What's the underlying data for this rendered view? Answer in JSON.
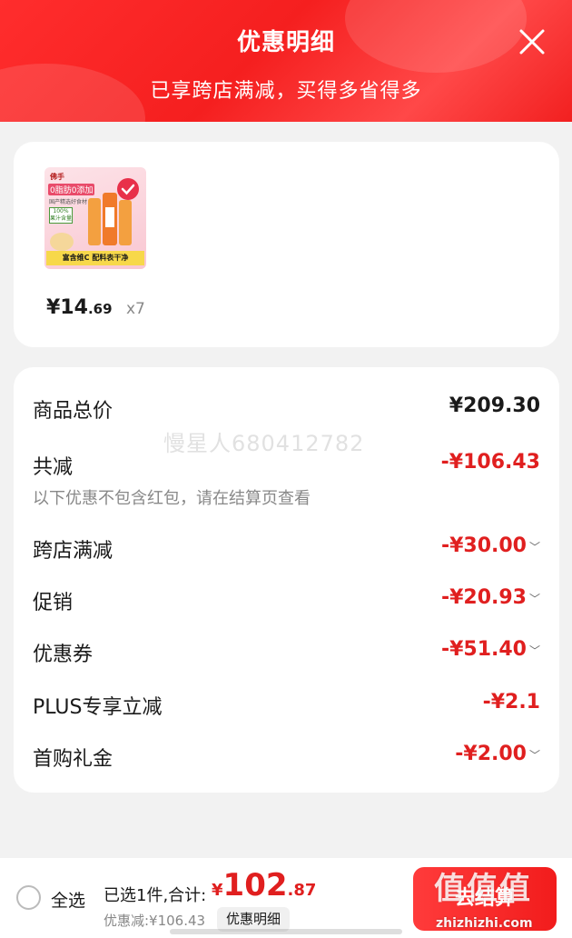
{
  "header": {
    "title": "优惠明细",
    "subtitle": "已享跨店满减，买得多省得多"
  },
  "product": {
    "image_brand": "佛手",
    "image_tag_main": "0脂肪0添加",
    "image_tag_sub": "国产精选好食材",
    "image_tag_pct": "100%",
    "image_tag_pct_sub": "果汁含量",
    "image_banner": "富含维C 配料表干净",
    "price_int": "¥14",
    "price_dec": ".69",
    "quantity": "x7"
  },
  "summary": {
    "goods_total_label": "商品总价",
    "goods_total_value": "¥209.30",
    "total_reduce_label": "共减",
    "total_reduce_value": "-¥106.43",
    "note": "以下优惠不包含红包，请在结算页查看",
    "items": [
      {
        "label": "跨店满减",
        "value": "-¥30.00",
        "expandable": true
      },
      {
        "label": "促销",
        "value": "-¥20.93",
        "expandable": true
      },
      {
        "label": "优惠券",
        "value": "-¥51.40",
        "expandable": true
      },
      {
        "label": "PLUS专享立减",
        "value": "-¥2.1",
        "expandable": false
      },
      {
        "label": "首购礼金",
        "value": "-¥2.00",
        "expandable": true
      }
    ]
  },
  "watermark": "慢星人680412782",
  "bottom_bar": {
    "select_all": "全选",
    "selected_text": "已选1件,合计:",
    "total_currency": "¥",
    "total_int": "102",
    "total_dec": ".87",
    "saved_text": "优惠减:¥106.43",
    "detail_button": "优惠明细",
    "checkout_button": "去结算"
  },
  "site_watermark": {
    "big": "值值值",
    "small": "zhizhizhi.com"
  },
  "colors": {
    "accent": "#e01f1f",
    "header_bg": "#f51f1f"
  }
}
